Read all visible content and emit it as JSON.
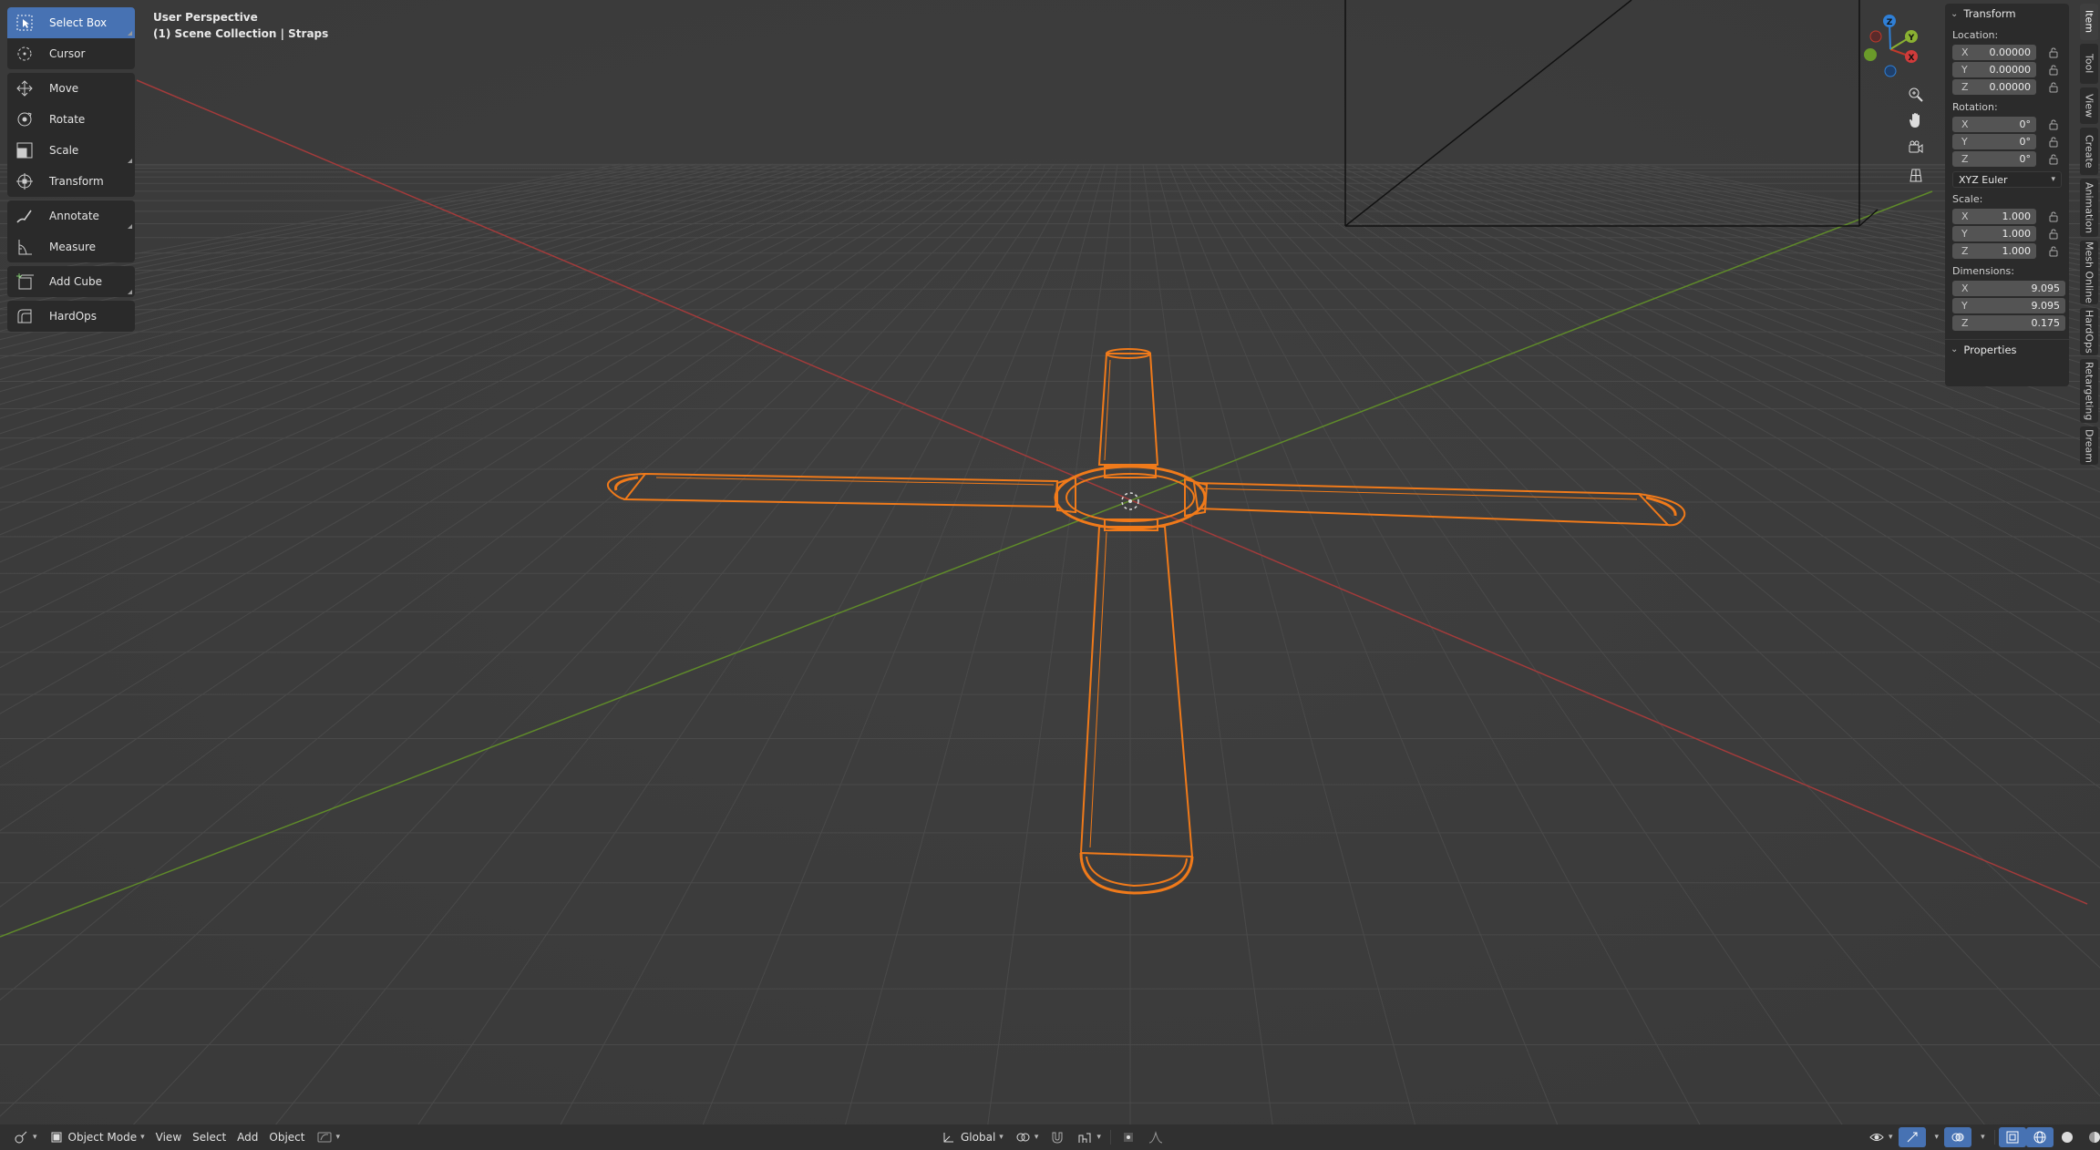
{
  "viewport": {
    "perspective_label": "User Perspective",
    "collection_label": "(1) Scene Collection | Straps"
  },
  "toolbar": {
    "tools": [
      {
        "label": "Select Box",
        "icon": "select-box-icon",
        "active": true
      },
      {
        "label": "Cursor",
        "icon": "cursor-icon"
      },
      {
        "label": "Move",
        "icon": "move-icon"
      },
      {
        "label": "Rotate",
        "icon": "rotate-icon"
      },
      {
        "label": "Scale",
        "icon": "scale-icon"
      },
      {
        "label": "Transform",
        "icon": "transform-icon"
      },
      {
        "label": "Annotate",
        "icon": "annotate-icon"
      },
      {
        "label": "Measure",
        "icon": "measure-icon"
      },
      {
        "label": "Add Cube",
        "icon": "add-cube-icon"
      },
      {
        "label": "HardOps",
        "icon": "hardops-icon"
      }
    ]
  },
  "npanel": {
    "transform_header": "Transform",
    "location_label": "Location:",
    "location": [
      {
        "axis": "X",
        "value": "0.00000"
      },
      {
        "axis": "Y",
        "value": "0.00000"
      },
      {
        "axis": "Z",
        "value": "0.00000"
      }
    ],
    "rotation_label": "Rotation:",
    "rotation": [
      {
        "axis": "X",
        "value": "0°"
      },
      {
        "axis": "Y",
        "value": "0°"
      },
      {
        "axis": "Z",
        "value": "0°"
      }
    ],
    "rotation_mode": "XYZ Euler",
    "scale_label": "Scale:",
    "scale": [
      {
        "axis": "X",
        "value": "1.000"
      },
      {
        "axis": "Y",
        "value": "1.000"
      },
      {
        "axis": "Z",
        "value": "1.000"
      }
    ],
    "dimensions_label": "Dimensions:",
    "dimensions": [
      {
        "axis": "X",
        "value": "9.095"
      },
      {
        "axis": "Y",
        "value": "9.095"
      },
      {
        "axis": "Z",
        "value": "0.175"
      }
    ],
    "properties_header": "Properties"
  },
  "side_tabs": [
    "Item",
    "Tool",
    "View",
    "Create",
    "Animation",
    "Mesh Online",
    "HardOps",
    "Retargeting",
    "Dream"
  ],
  "gizmo": {
    "x": "X",
    "y": "Y",
    "z": "Z"
  },
  "bottombar": {
    "mode": "Object Mode",
    "menus": [
      "View",
      "Select",
      "Add",
      "Object"
    ],
    "orientation": "Global"
  },
  "colors": {
    "accent": "#4772b3",
    "selection": "#f07a1a",
    "x_axis": "#c0392b",
    "y_axis": "#6a9a2a",
    "z_axis": "#2f7fd6"
  }
}
